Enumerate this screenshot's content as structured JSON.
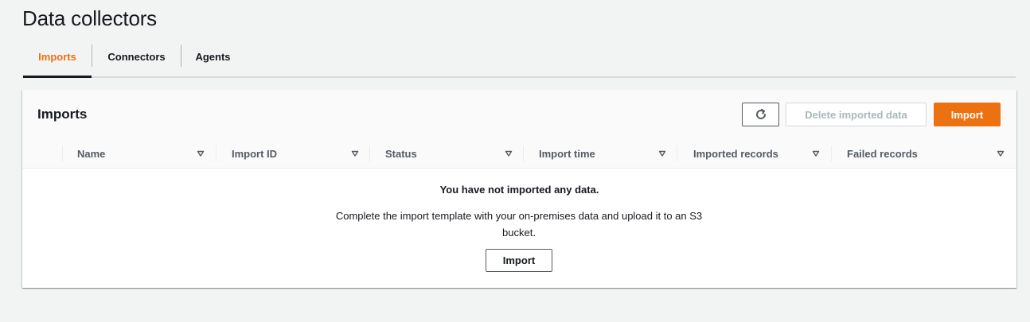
{
  "page": {
    "title": "Data collectors"
  },
  "tabs": [
    {
      "label": "Imports",
      "active": true
    },
    {
      "label": "Connectors",
      "active": false
    },
    {
      "label": "Agents",
      "active": false
    }
  ],
  "panel": {
    "title": "Imports",
    "refresh_icon": "refresh-icon",
    "delete_label": "Delete imported data",
    "import_label": "Import"
  },
  "table": {
    "columns": [
      {
        "label": "Name"
      },
      {
        "label": "Import ID"
      },
      {
        "label": "Status"
      },
      {
        "label": "Import time"
      },
      {
        "label": "Imported records"
      },
      {
        "label": "Failed records"
      }
    ],
    "sort_icon": "caret-down-outline-icon"
  },
  "empty_state": {
    "title": "You have not imported any data.",
    "description": "Complete the import template with your on-premises data and upload it to an S3 bucket.",
    "button_label": "Import"
  },
  "colors": {
    "accent": "#ec7211",
    "text": "#16191f",
    "muted": "#545b64",
    "disabled": "#aab7b8"
  }
}
